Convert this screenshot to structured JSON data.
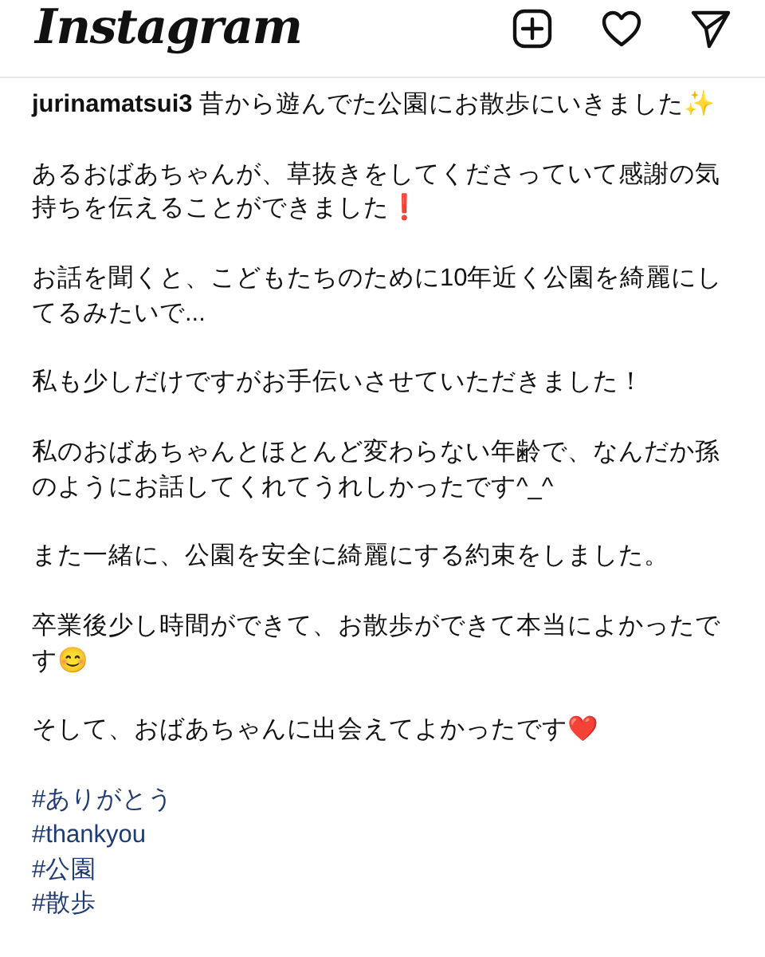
{
  "header": {
    "logo": "Instagram",
    "actions": [
      {
        "kind": "new-post"
      },
      {
        "kind": "activity"
      },
      {
        "kind": "direct"
      }
    ]
  },
  "caption": [
    {
      "text": "**jurinamatsui3** 昔から遊んでた公園にお散歩にいきました✨"
    },
    {
      "text": "あるおばあちゃんが、草抜きをしてくださっていて感謝の気持ちを伝えることができました❗"
    },
    {
      "text": "お話を聞くと、こどもたちのために10年近く公園を綺麗にしてるみたいで..."
    },
    {
      "text": "私も少しだけですがお手伝いさせていただきました！"
    },
    {
      "text": "私のおばあちゃんとほとんど変わらない年齢で、なんだか孫のようにお話してくれてうれしかったです^_^"
    },
    {
      "text": "また一緒に、公園を安全に綺麗にする約束をしました。"
    },
    {
      "text": "卒業後少し時間ができて、お散歩ができて本当によかったです😊"
    },
    {
      "text": "そして、おばあちゃんに出会えてよかったです❤️"
    }
  ],
  "hashtags": [
    "#ありがとう",
    "#thankyou",
    "#公園",
    "#散歩"
  ]
}
